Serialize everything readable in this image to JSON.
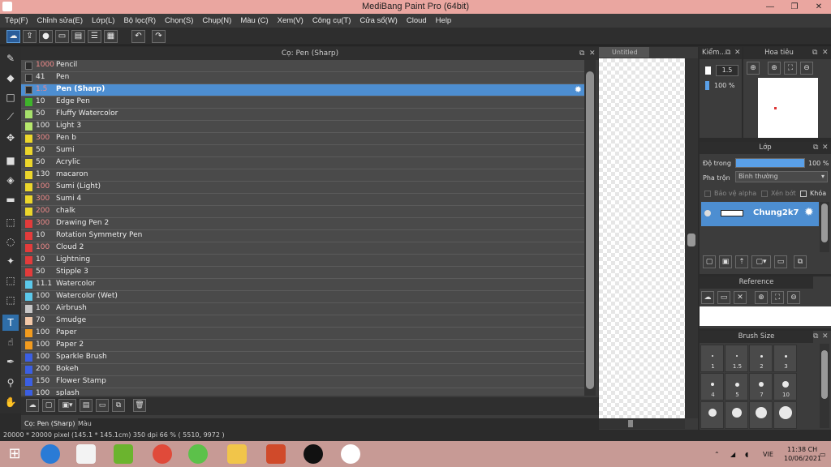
{
  "window": {
    "title": "MediBang Paint Pro (64bit)",
    "minimize": "—",
    "maximize": "❐",
    "close": "✕"
  },
  "menu": [
    "Tệp(F)",
    "Chỉnh sửa(E)",
    "Lớp(L)",
    "Bộ lọc(R)",
    "Chọn(S)",
    "Chụp(N)",
    "Màu (C)",
    "Xem(V)",
    "Công cụ(T)",
    "Cửa sổ(W)",
    "Cloud",
    "Help"
  ],
  "toolbar": {
    "icons": [
      "cloud-icon",
      "upload-icon",
      "chat-icon",
      "comment-icon",
      "document-icon",
      "list-icon",
      "grid-icon",
      "undo-icon",
      "redo-icon"
    ]
  },
  "brush_panel": {
    "title": "Cọ: Pen (Sharp)",
    "brushes": [
      {
        "size": "1000",
        "name": "Pencil",
        "color": "#2b2b2b",
        "size_red": true
      },
      {
        "size": "41",
        "name": "Pen",
        "color": "#2b2b2b",
        "size_red": false
      },
      {
        "size": "1.5",
        "name": "Pen (Sharp)",
        "color": "#2b2b2b",
        "size_red": true,
        "selected": true
      },
      {
        "size": "10",
        "name": "Edge Pen",
        "color": "#3fb42b",
        "size_red": false
      },
      {
        "size": "50",
        "name": "Fluffy Watercolor",
        "color": "#a6e06b",
        "size_red": false
      },
      {
        "size": "100",
        "name": "Light 3",
        "color": "#b8e86c",
        "size_red": false
      },
      {
        "size": "300",
        "name": " Pen b",
        "color": "#ecd62b",
        "size_red": true
      },
      {
        "size": "50",
        "name": "Sumi",
        "color": "#ecd62b",
        "size_red": false
      },
      {
        "size": "50",
        "name": "Acrylic",
        "color": "#ecd62b",
        "size_red": false
      },
      {
        "size": "130",
        "name": "macaron",
        "color": "#ecd62b",
        "size_red": false
      },
      {
        "size": "100",
        "name": "Sumi (Light)",
        "color": "#ecd62b",
        "size_red": true
      },
      {
        "size": "300",
        "name": "Sumi 4",
        "color": "#ecd62b",
        "size_red": true
      },
      {
        "size": "200",
        "name": "chalk",
        "color": "#ecd62b",
        "size_red": true
      },
      {
        "size": "300",
        "name": "Drawing Pen 2",
        "color": "#e33b3b",
        "size_red": true
      },
      {
        "size": "10",
        "name": "Rotation Symmetry Pen",
        "color": "#e33b3b",
        "size_red": false
      },
      {
        "size": "100",
        "name": "Cloud 2",
        "color": "#e33b3b",
        "size_red": true
      },
      {
        "size": "10",
        "name": "Lightning",
        "color": "#e33b3b",
        "size_red": false
      },
      {
        "size": "50",
        "name": "Stipple 3",
        "color": "#e33b3b",
        "size_red": false
      },
      {
        "size": "11.1",
        "name": "Watercolor",
        "color": "#5bc8ea",
        "size_red": false
      },
      {
        "size": "100",
        "name": "Watercolor (Wet)",
        "color": "#5bc8ea",
        "size_red": false
      },
      {
        "size": "100",
        "name": "Airbrush",
        "color": "#c7c7c7",
        "size_red": false
      },
      {
        "size": "70",
        "name": "Smudge",
        "color": "#f2c8a8",
        "size_red": false
      },
      {
        "size": "100",
        "name": "Paper",
        "color": "#f29b1e",
        "size_red": false
      },
      {
        "size": "100",
        "name": "Paper 2",
        "color": "#f29b1e",
        "size_red": false
      },
      {
        "size": "100",
        "name": "Sparkle Brush",
        "color": "#3b5fe3",
        "size_red": false
      },
      {
        "size": "200",
        "name": "Bokeh",
        "color": "#3b5fe3",
        "size_red": false
      },
      {
        "size": "150",
        "name": "Flower Stamp",
        "color": "#3b5fe3",
        "size_red": false
      },
      {
        "size": "100",
        "name": "splash",
        "color": "#3b5fe3",
        "size_red": false
      }
    ],
    "tabs": [
      "Cọ: Pen (Sharp)",
      "Màu"
    ]
  },
  "canvas": {
    "tab": "Untitled"
  },
  "kiem_panel": {
    "title": "Kiểm...",
    "size": "1.5",
    "opacity": "100 %"
  },
  "navigator": {
    "title": "Hoa tiêu"
  },
  "layer_panel": {
    "title": "Lớp",
    "opacity_label": "Độ trong",
    "opacity_value": "100 %",
    "opacity_fraction": 1.0,
    "blend_label": "Pha trộn",
    "blend_value": "Bình thường",
    "protect_alpha": "Bảo vệ alpha",
    "clipping": "Xén bớt",
    "lock": "Khóa",
    "layer_name": "Chung2k7"
  },
  "reference_panel": {
    "title": "Reference"
  },
  "brush_size_panel": {
    "title": "Brush Size",
    "sizes": [
      "1",
      "1.5",
      "2",
      "3",
      "4",
      "5",
      "7",
      "10",
      "",
      "",
      "",
      ""
    ]
  },
  "status": {
    "text": "20000 * 20000 pixel  (145.1 * 145.1cm)  350 dpi  66 %  ( 5510, 9972 )"
  },
  "taskbar": {
    "lang": "VIE",
    "time": "11:38 CH",
    "date": "10/06/2021"
  }
}
